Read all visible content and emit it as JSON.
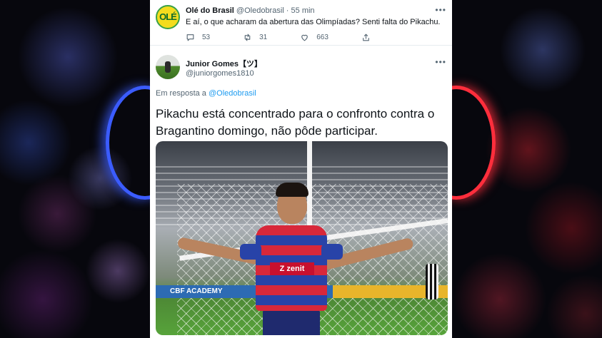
{
  "tweet1": {
    "avatar_text": "OLÉ",
    "name": "Olé do Brasil",
    "handle": "@Oledobrasil",
    "separator": "·",
    "time": "55 min",
    "text": "E aí, o que acharam da abertura das Olimpíadas? Senti falta do Pikachu.",
    "more": "•••",
    "replies": "53",
    "retweets": "31",
    "likes": "663"
  },
  "tweet2": {
    "name": "Junior Gomes【ツ】",
    "handle": "@juniorgomes1810",
    "more": "•••",
    "reply_prefix": "Em resposta a",
    "reply_to": "@Oledobrasil",
    "text": "Pikachu está concentrado para o confronto contra o Bragantino domingo, não pôde participar.",
    "photo": {
      "sponsor": "Z zenit",
      "ad_text": "CBF ACADEMY"
    }
  },
  "icons": {
    "reply": "comment-icon",
    "retweet": "retweet-icon",
    "like": "heart-icon",
    "share": "share-icon",
    "more": "more-icon"
  },
  "colors": {
    "link": "#1d9bf0",
    "muted": "#536471",
    "text": "#0f1419",
    "ring_left": "#3b5cff",
    "ring_right": "#ff2e3c"
  }
}
